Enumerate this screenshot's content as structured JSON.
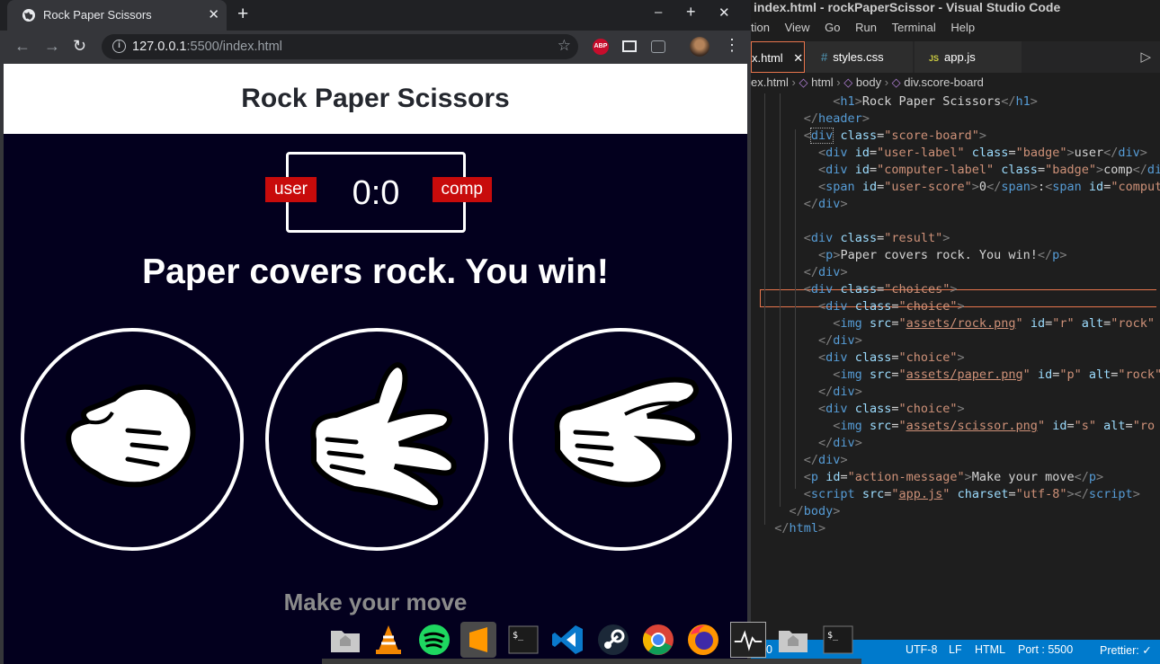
{
  "browser": {
    "tab_title": "Rock Paper Scissors",
    "tab_close": "✕",
    "new_tab": "+",
    "minimize": "–",
    "maximize": "+",
    "close": "✕",
    "url_host": "127.0.0.1",
    "url_rest": ":5500/index.html",
    "menu": "⋮",
    "abp_label": "ABP"
  },
  "page": {
    "title": "Rock Paper Scissors",
    "user_label": "user",
    "comp_label": "comp",
    "score": "0:0",
    "result": "Paper covers rock. You win!",
    "action_message": "Make your move",
    "choices": [
      "rock",
      "paper",
      "scissors"
    ]
  },
  "vscode": {
    "title": "index.html - rockPaperScissor - Visual Studio Code",
    "menu": [
      "tion",
      "View",
      "Go",
      "Run",
      "Terminal",
      "Help"
    ],
    "tabs": [
      {
        "label": "x.html",
        "close": "✕",
        "icon": ""
      },
      {
        "label": "styles.css",
        "icon": "#"
      },
      {
        "label": "app.js",
        "icon": "JS"
      }
    ],
    "breadcrumb": [
      "ex.html",
      "html",
      "body",
      "div.score-board"
    ],
    "status": {
      "encoding": "UTF-8",
      "eol": "LF",
      "language": "HTML",
      "port": "Port : 5500",
      "prettier": "Prettier: ✓",
      "partial": "10"
    }
  },
  "dock": {
    "items": [
      "files",
      "vlc",
      "spotify",
      "sublime-text",
      "terminal",
      "vscode",
      "steam",
      "chrome",
      "firefox",
      "system-monitor",
      "files",
      "terminal"
    ]
  }
}
